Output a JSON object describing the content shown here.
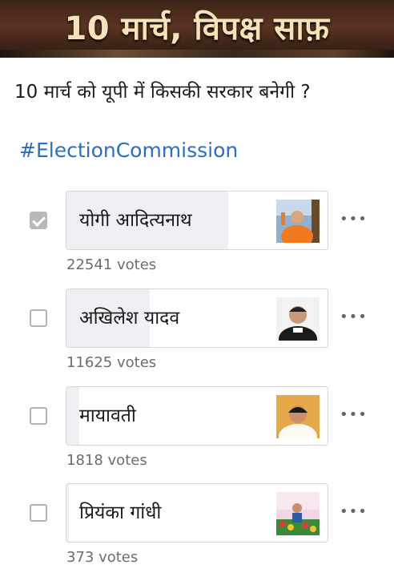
{
  "banner": {
    "title": "10 मार्च, विपक्ष साफ़"
  },
  "poll": {
    "question": "10 मार्च को यूपी में किसकी सरकार बनेगी ?",
    "hashtag": "#ElectionCommission",
    "options": [
      {
        "label": "योगी आदित्यनाथ",
        "votes": "22541 votes",
        "checked": true,
        "share": 0.621
      },
      {
        "label": "अखिलेश यादव",
        "votes": "11625 votes",
        "checked": false,
        "share": 0.32
      },
      {
        "label": "मायावती",
        "votes": "1818 votes",
        "checked": false,
        "share": 0.05
      },
      {
        "label": "प्रियंका गांधी",
        "votes": "373 votes",
        "checked": false,
        "share": 0.01
      }
    ],
    "more_label": "•••"
  },
  "colors": {
    "hashtag": "#2a6ec6",
    "fill": "#eef0f3",
    "checked": "#b9b9b9"
  }
}
